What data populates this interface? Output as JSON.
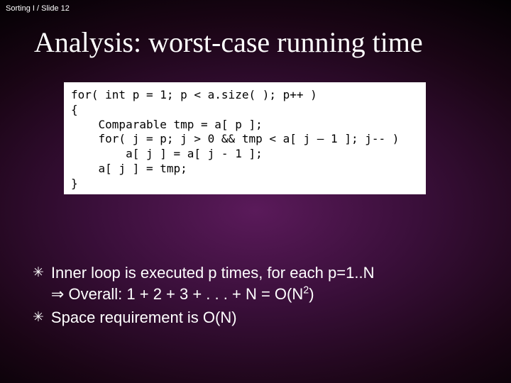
{
  "header": {
    "text": "Sorting I  / Slide 12"
  },
  "title": "Analysis: worst-case running time",
  "code": {
    "line1": "for( int p = 1; p < a.size( ); p++ )",
    "line2": "{",
    "line3": "    Comparable tmp = a[ p ];",
    "line4": "    for( j = p; j > 0 && tmp < a[ j – 1 ]; j-- )",
    "line5": "        a[ j ] = a[ j - 1 ];",
    "line6": "    a[ j ] = tmp;",
    "line7": "}"
  },
  "bullets": {
    "b1_line1": "Inner loop is executed p times, for each p=1..N",
    "b1_arrow": "⇒",
    "b1_line2a": " Overall: 1 + 2 + 3 + . . . + N  = O(N",
    "b1_sup": "2",
    "b1_line2b": ")",
    "b2": "Space requirement is O(N)"
  },
  "markers": {
    "asterisk": "✳"
  }
}
